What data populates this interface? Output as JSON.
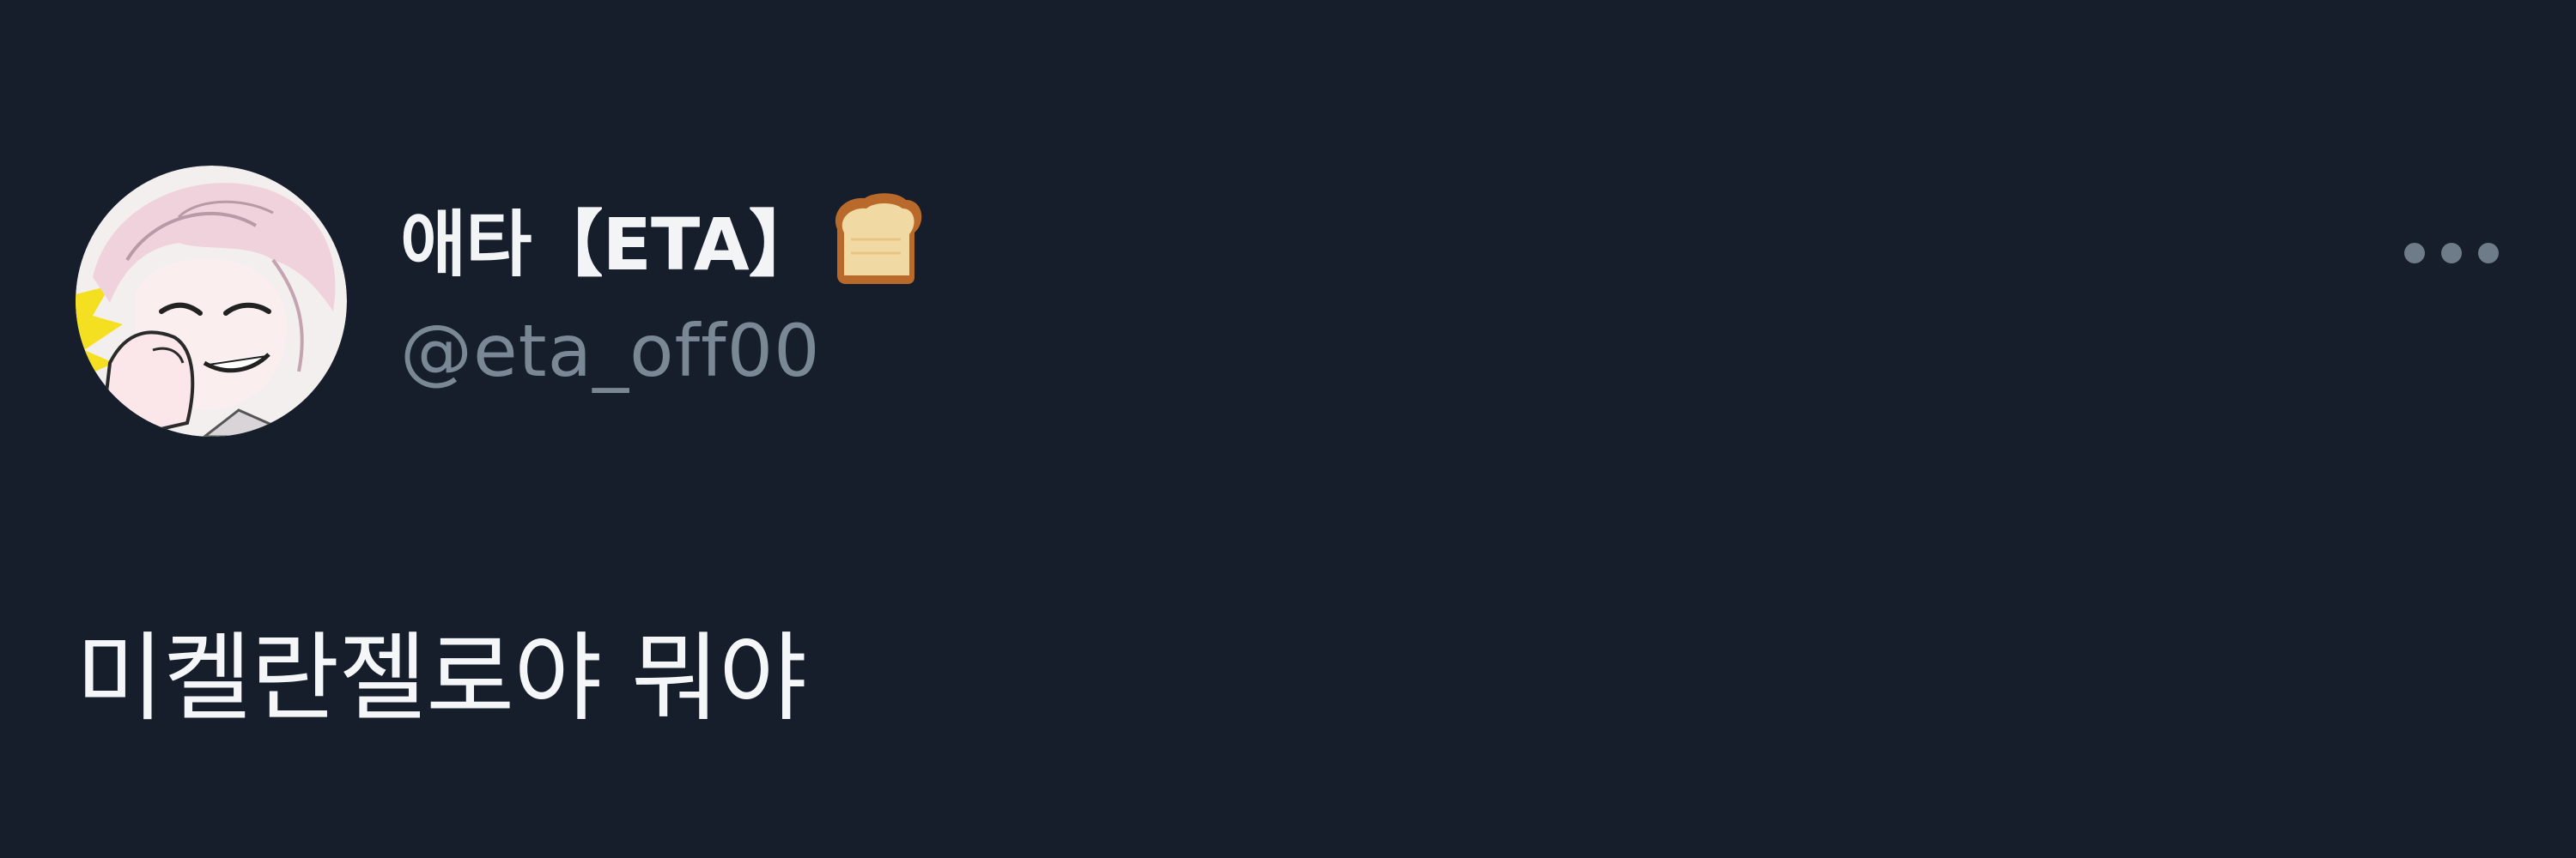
{
  "tweet": {
    "author": {
      "display_name": "애타【ETA】",
      "badge_icon": "bread-icon",
      "handle": "@eta_off00",
      "avatar_icon": "avatar-anime-character"
    },
    "text": "미켈란젤로야 뭐야",
    "more_icon": "more-options-icon"
  },
  "colors": {
    "background": "#151e2a",
    "name": "#f2f4f6",
    "handle": "#7a8795",
    "text": "#f4f6f8",
    "icon": "#6e7b89"
  }
}
